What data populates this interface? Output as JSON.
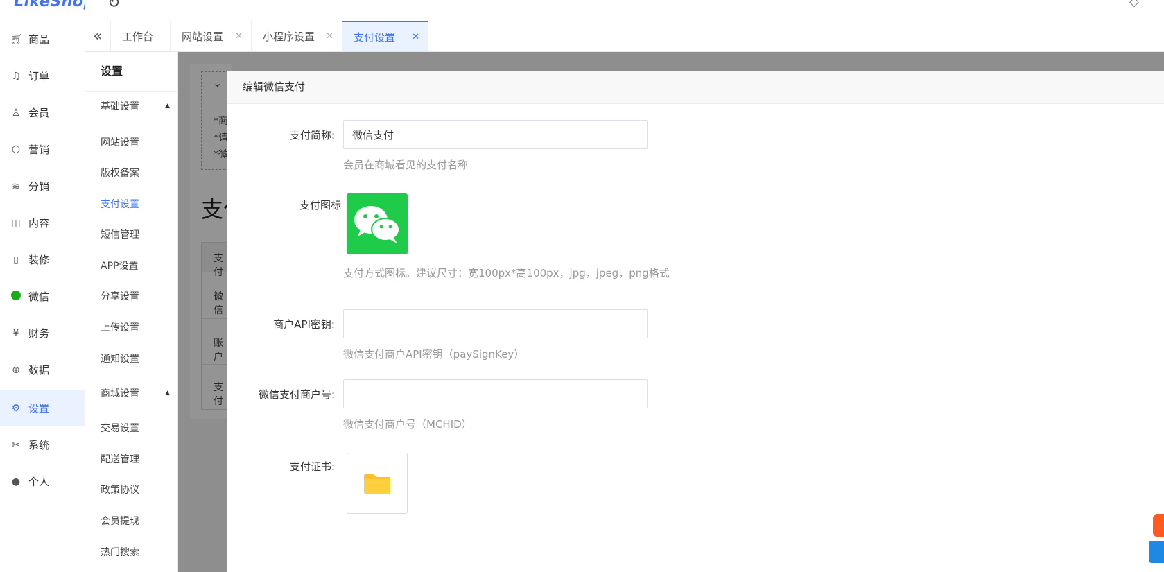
{
  "brand": {
    "logo_text": "LikeShop"
  },
  "sidebar": {
    "items": [
      {
        "label": "商品",
        "icon": "cart-icon"
      },
      {
        "label": "订单",
        "icon": "bell-icon"
      },
      {
        "label": "会员",
        "icon": "user-icon"
      },
      {
        "label": "营销",
        "icon": "cube-icon"
      },
      {
        "label": "分销",
        "icon": "layers-icon"
      },
      {
        "label": "内容",
        "icon": "book-icon"
      },
      {
        "label": "装修",
        "icon": "phone-icon"
      },
      {
        "label": "微信",
        "icon": "wechat-icon"
      },
      {
        "label": "财务",
        "icon": "yen-icon"
      },
      {
        "label": "数据",
        "icon": "globe-icon"
      },
      {
        "label": "设置",
        "icon": "gear-icon",
        "active": true
      },
      {
        "label": "系统",
        "icon": "tools-icon"
      },
      {
        "label": "个人",
        "icon": "person-icon"
      }
    ]
  },
  "tabs": [
    {
      "label": "工作台",
      "closable": false
    },
    {
      "label": "网站设置",
      "closable": true
    },
    {
      "label": "小程序设置",
      "closable": true
    },
    {
      "label": "支付设置",
      "closable": true,
      "active": true
    }
  ],
  "submenu": {
    "title": "设置",
    "group1": "基础设置",
    "group1_items": [
      "网站设置",
      "版权备案",
      "支付设置",
      "短信管理",
      "APP设置",
      "分享设置",
      "上传设置",
      "通知设置"
    ],
    "group2": "商城设置",
    "group2_items": [
      "交易设置",
      "配送管理",
      "政策协议",
      "会员提现",
      "热门搜索"
    ]
  },
  "background_page": {
    "tips": [
      "*商",
      "*请",
      "*微"
    ],
    "title": "支付",
    "table_cells": [
      "支付",
      "微信",
      "账户",
      "支付"
    ]
  },
  "modal": {
    "title": "编辑微信支付",
    "fields": {
      "name_label": "支付简称:",
      "name_value": "微信支付",
      "name_help": "会员在商城看见的支付名称",
      "icon_label": "支付图标",
      "icon_help": "支付方式图标。建议尺寸：宽100px*高100px，jpg，jpeg，png格式",
      "apikey_label": "商户API密钥:",
      "apikey_value": "",
      "apikey_help": "微信支付商户API密钥（paySignKey）",
      "mchid_label": "微信支付商户号:",
      "mchid_value": "",
      "mchid_help": "微信支付商户号（MCHID）",
      "cert_label": "支付证书:"
    }
  },
  "colors": {
    "accent": "#4073fa",
    "wechat_green": "#1fcc49",
    "folder_yellow": "#ffc12a"
  }
}
